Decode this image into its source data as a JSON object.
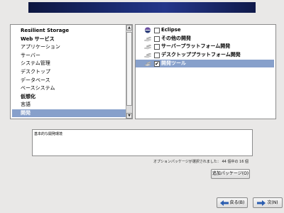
{
  "categories": [
    {
      "label": "Resilient Storage",
      "bold": true
    },
    {
      "label": "Web サービス",
      "bold": true
    },
    {
      "label": "アプリケーション",
      "bold": false
    },
    {
      "label": "サーバー",
      "bold": false
    },
    {
      "label": "システム管理",
      "bold": false
    },
    {
      "label": "デスクトップ",
      "bold": false
    },
    {
      "label": "データベース",
      "bold": false
    },
    {
      "label": "ベースシステム",
      "bold": false
    },
    {
      "label": "仮想化",
      "bold": true
    },
    {
      "label": "言語",
      "bold": false
    },
    {
      "label": "開発",
      "bold": true,
      "selected": true
    }
  ],
  "options": [
    {
      "label": "Eclipse",
      "checked": false,
      "icon": "eclipse-icon",
      "bold": true
    },
    {
      "label": "その他の開発",
      "checked": false,
      "icon": "package-icon",
      "bold": true
    },
    {
      "label": "サーバープラットフォーム開発",
      "checked": false,
      "icon": "package-icon",
      "bold": true
    },
    {
      "label": "デスクトッププラットフォーム開発",
      "checked": false,
      "icon": "package-icon",
      "bold": true
    },
    {
      "label": "開発ツール",
      "checked": true,
      "icon": "package-icon",
      "bold": true,
      "selected": true
    }
  ],
  "description": "基本的な開発環境",
  "status": "オプションパッケージが選択されました： 44 個中の 16 個",
  "buttons": {
    "add_package": "追加パッケージ(O)",
    "back": "戻る(B)",
    "next": "次(N)"
  },
  "colors": {
    "selection": "#87a0cb",
    "banner": "#1d2f79"
  }
}
